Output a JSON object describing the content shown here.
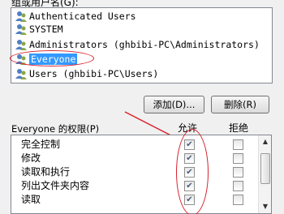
{
  "group_label": "组或用户名(G):",
  "users": [
    {
      "name": "Authenticated Users",
      "icon": "users-group-icon",
      "selected": false
    },
    {
      "name": "SYSTEM",
      "icon": "users-group-icon",
      "selected": false
    },
    {
      "name": "Administrators (ghbibi-PC\\Administrators)",
      "icon": "users-group-icon",
      "selected": false
    },
    {
      "name": "Everyone",
      "icon": "users-group-icon",
      "selected": true
    },
    {
      "name": "Users (ghbibi-PC\\Users)",
      "icon": "users-group-icon",
      "selected": false
    }
  ],
  "buttons": {
    "add": "添加(D)...",
    "remove": "删除(R)"
  },
  "permissions_label": "Everyone 的权限(P)",
  "columns": {
    "allow": "允许",
    "deny": "拒绝"
  },
  "permissions": [
    {
      "name": "完全控制",
      "allow": true,
      "deny": false
    },
    {
      "name": "修改",
      "allow": true,
      "deny": false
    },
    {
      "name": "读取和执行",
      "allow": true,
      "deny": false
    },
    {
      "name": "列出文件夹内容",
      "allow": true,
      "deny": false
    },
    {
      "name": "读取",
      "allow": true,
      "deny": false
    }
  ],
  "annotation_color": "#d8202a",
  "selection_color": "#3399ff"
}
